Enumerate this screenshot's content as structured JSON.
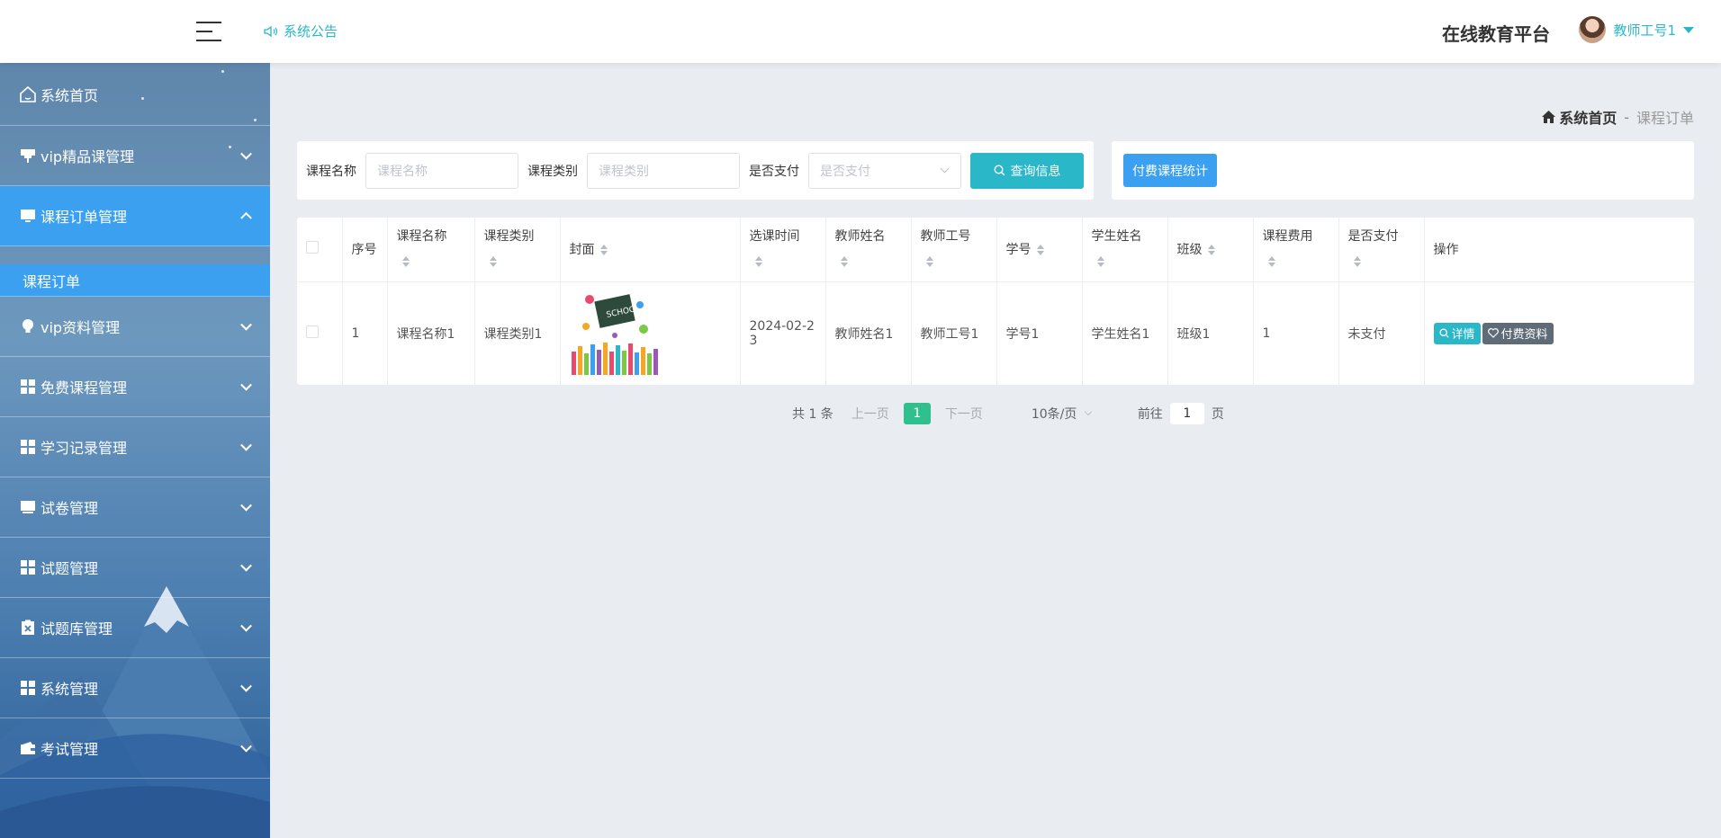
{
  "header": {
    "notice_label": "系统公告",
    "platform_title": "在线教育平台",
    "user_label": "教师工号1"
  },
  "sidebar": {
    "items": [
      {
        "label": "系统首页",
        "icon": "home-icon"
      },
      {
        "label": "vip精品课管理",
        "icon": "pin-icon"
      },
      {
        "label": "课程订单管理",
        "icon": "monitor-icon"
      },
      {
        "label": "vip资料管理",
        "icon": "bulb-icon"
      },
      {
        "label": "免费课程管理",
        "icon": "grid-icon"
      },
      {
        "label": "学习记录管理",
        "icon": "grid-icon"
      },
      {
        "label": "试卷管理",
        "icon": "monitor-icon"
      },
      {
        "label": "试题管理",
        "icon": "grid-icon"
      },
      {
        "label": "试题库管理",
        "icon": "clipboard-x-icon"
      },
      {
        "label": "系统管理",
        "icon": "grid-icon"
      },
      {
        "label": "考试管理",
        "icon": "wallet-icon"
      }
    ],
    "submenu": {
      "label": "课程订单"
    }
  },
  "breadcrumb": {
    "home": "系统首页",
    "separator": "-",
    "current": "课程订单"
  },
  "search": {
    "course_name_label": "课程名称",
    "course_name_placeholder": "课程名称",
    "course_type_label": "课程类别",
    "course_type_placeholder": "课程类别",
    "paid_label": "是否支付",
    "paid_placeholder": "是否支付",
    "query_button": "查询信息"
  },
  "stats_button": "付费课程统计",
  "table": {
    "columns": [
      "序号",
      "课程名称",
      "课程类别",
      "封面",
      "选课时间",
      "教师姓名",
      "教师工号",
      "学号",
      "学生姓名",
      "班级",
      "课程费用",
      "是否支付",
      "操作"
    ],
    "rows": [
      {
        "index": "1",
        "course_name": "课程名称1",
        "course_type": "课程类别1",
        "select_time_1": "2024-02-2",
        "select_time_2": "3",
        "teacher_name": "教师姓名1",
        "teacher_id": "教师工号1",
        "student_no": "学号1",
        "student_name": "学生姓名1",
        "class": "班级1",
        "fee": "1",
        "paid": "未支付",
        "detail_button": "详情",
        "paid_material_button": "付费资料"
      }
    ]
  },
  "pagination": {
    "total": "共 1 条",
    "prev": "上一页",
    "current_page": "1",
    "next": "下一页",
    "page_size": "10条/页",
    "goto_prefix": "前往",
    "goto_value": "1",
    "goto_suffix": "页"
  },
  "colors": {
    "accent_teal": "#2ab7c7",
    "accent_blue": "#3aa0ef",
    "page_green": "#2fc08e"
  }
}
